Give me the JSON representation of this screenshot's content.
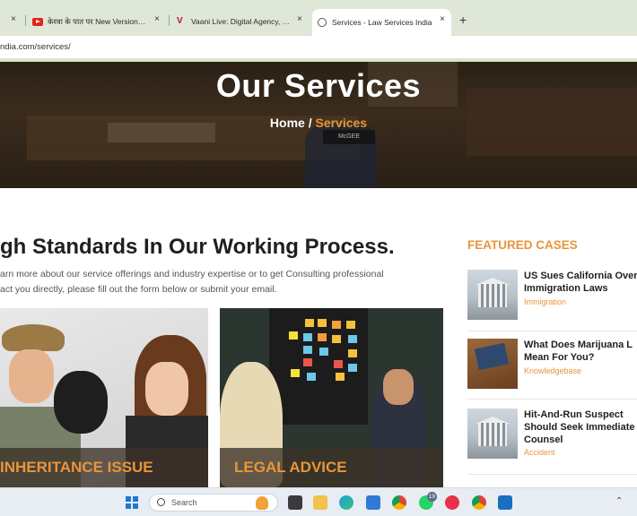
{
  "browser": {
    "tabs": [
      {
        "title": "केरवा के पात पर New Version, K",
        "icon": "youtube-icon"
      },
      {
        "title": "Vaani Live: Digital Agency, Web",
        "icon": "vaani-icon"
      },
      {
        "title": "Services - Law Services India",
        "icon": "globe-icon",
        "active": true
      }
    ],
    "first_tab_close": "×",
    "new_tab": "+",
    "url": "ndia.com/services/"
  },
  "hero": {
    "title": "Our Services",
    "breadcrumb_home": "Home",
    "breadcrumb_sep": " / ",
    "breadcrumb_current": "Services",
    "nameplate": "McGEE"
  },
  "main": {
    "heading": "gh Standards In Our Working Process.",
    "intro_line1": "arn more about our service offerings and industry expertise or to get Consulting professional",
    "intro_line2": "act you directly, please fill out the form below or submit your email.",
    "cards": [
      {
        "label": "INHERITANCE ISSUE"
      },
      {
        "label": "LEGAL ADVICE"
      }
    ]
  },
  "sidebar": {
    "title": "FEATURED CASES",
    "cases": [
      {
        "title_l1": "US Sues California Over",
        "title_l2": "Immigration Laws",
        "category": "Immigration"
      },
      {
        "title_l1": "What Does Marijuana L",
        "title_l2": "Mean For You?",
        "category": "Knowledgebase"
      },
      {
        "title_l1": "Hit-And-Run Suspect",
        "title_l2": "Should Seek Immediate",
        "title_l3": "Counsel",
        "category": "Accident"
      }
    ]
  },
  "taskbar": {
    "search_placeholder": "Search",
    "whatsapp_badge": "19"
  },
  "colors": {
    "accent": "#e8953a",
    "tabstrip": "#dfe8d8"
  }
}
